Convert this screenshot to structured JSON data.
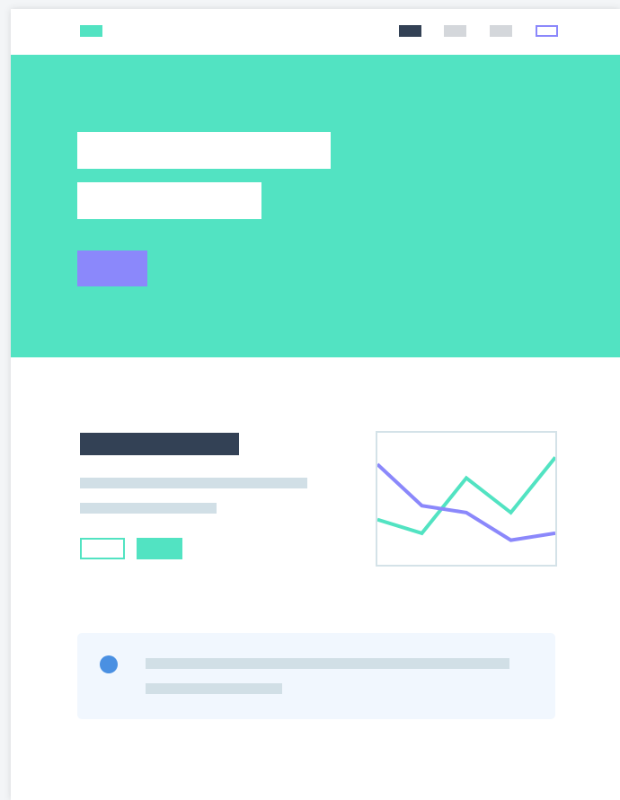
{
  "colors": {
    "accent_teal": "#52e3c2",
    "accent_purple": "#8b88fb",
    "dark_navy": "#334155",
    "placeholder_gray": "#d4d7db",
    "text_placeholder": "#d1dfe6",
    "info_background": "#f1f7fe",
    "info_dot": "#4a90e2",
    "chart_border": "#d4e2e8"
  },
  "nav": {
    "logo": "logo-placeholder",
    "items": [
      "nav-item-active",
      "nav-item",
      "nav-item",
      "nav-item-outline"
    ]
  },
  "hero": {
    "title_lines": 2,
    "button": "primary-button-placeholder"
  },
  "feature": {
    "heading": "heading-placeholder",
    "text_lines": 2,
    "buttons": [
      "outline-button",
      "filled-button"
    ]
  },
  "chart_data": {
    "type": "line",
    "x": [
      1,
      2,
      3,
      4,
      5,
      6
    ],
    "series": [
      {
        "color": "#52e3c2",
        "values": [
          2.5,
          1.5,
          5.5,
          3.0,
          7.0,
          null
        ]
      },
      {
        "color": "#8b88fb",
        "values": [
          6.5,
          3.5,
          3.0,
          1.0,
          1.5,
          null
        ]
      }
    ],
    "ylim": [
      0,
      8
    ],
    "grid": false,
    "legend": "none"
  },
  "info": {
    "icon": "info-dot-icon",
    "text_lines": 2
  }
}
